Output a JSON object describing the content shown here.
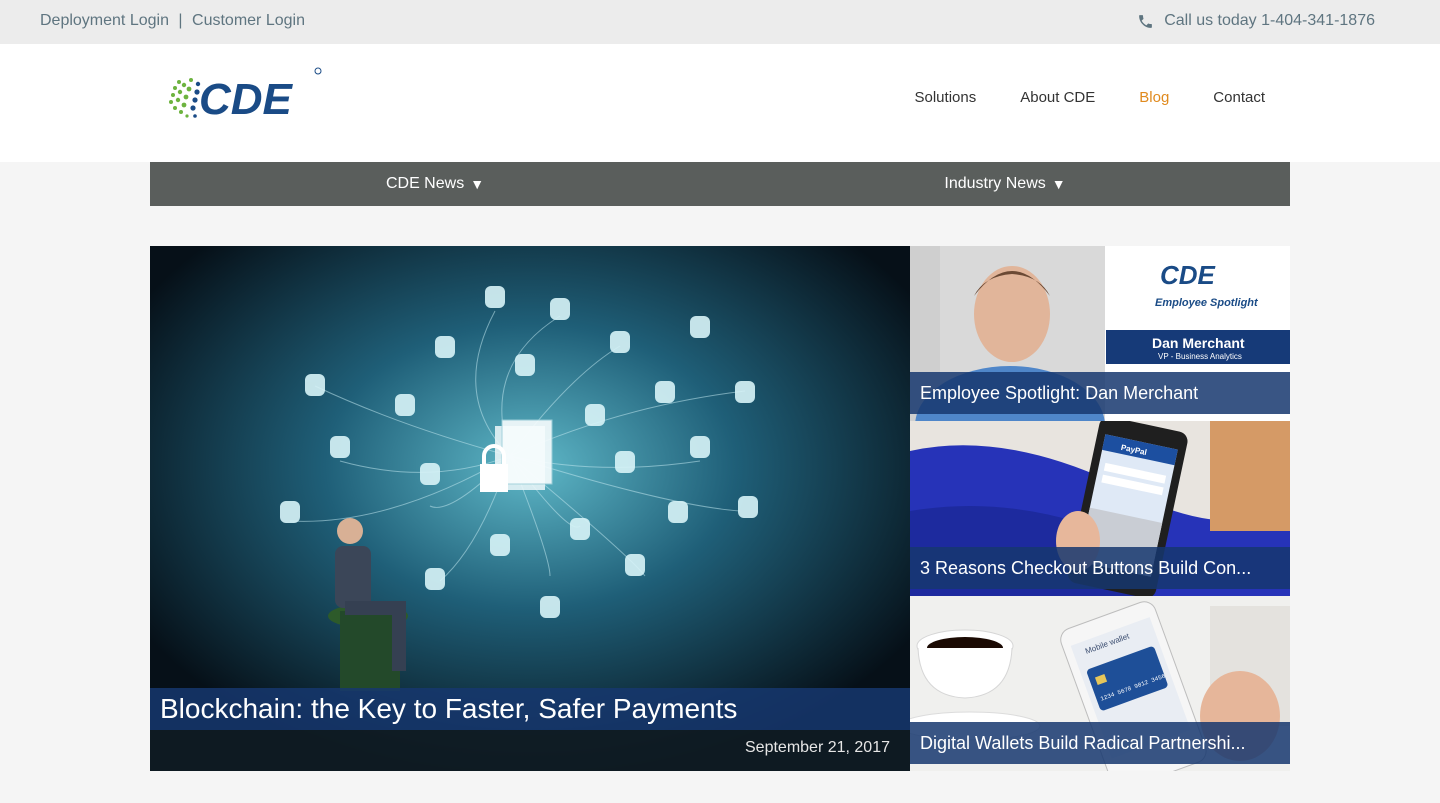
{
  "topbar": {
    "deployment_login": "Deployment Login",
    "separator": "|",
    "customer_login": "Customer Login",
    "phone_text": "Call us today 1-404-341-1876"
  },
  "header": {
    "logo_text": "CDE",
    "nav": [
      {
        "label": "Solutions"
      },
      {
        "label": "About CDE"
      },
      {
        "label": "Blog",
        "active": true
      },
      {
        "label": "Contact"
      }
    ]
  },
  "subnav": {
    "items": [
      {
        "label": "CDE News",
        "caret": "▼"
      },
      {
        "label": "Industry News",
        "caret": "▼"
      }
    ]
  },
  "featured": {
    "title": "Blockchain: the Key to Faster, Safer Payments",
    "date": "September 21, 2017"
  },
  "cards": [
    {
      "title": "Employee Spotlight: Dan Merchant",
      "image_text": {
        "logo": "CDE",
        "headline": "Employee Spotlight",
        "name": "Dan Merchant",
        "role": "VP - Business Analytics"
      }
    },
    {
      "title": "3 Reasons Checkout Buttons Build Con...",
      "image_text": {
        "app": "PayPal"
      }
    },
    {
      "title": "Digital Wallets Build Radical Partnershi...",
      "image_text": {
        "app": "Mobile wallet",
        "card_number": "1234 5678 9012 3456"
      }
    }
  ],
  "colors": {
    "accent": "#e08a1e",
    "caption_blue": "#16376e",
    "subnav": "#5a5e5c",
    "logo_blue": "#1a4b86",
    "logo_green": "#6db33f"
  }
}
